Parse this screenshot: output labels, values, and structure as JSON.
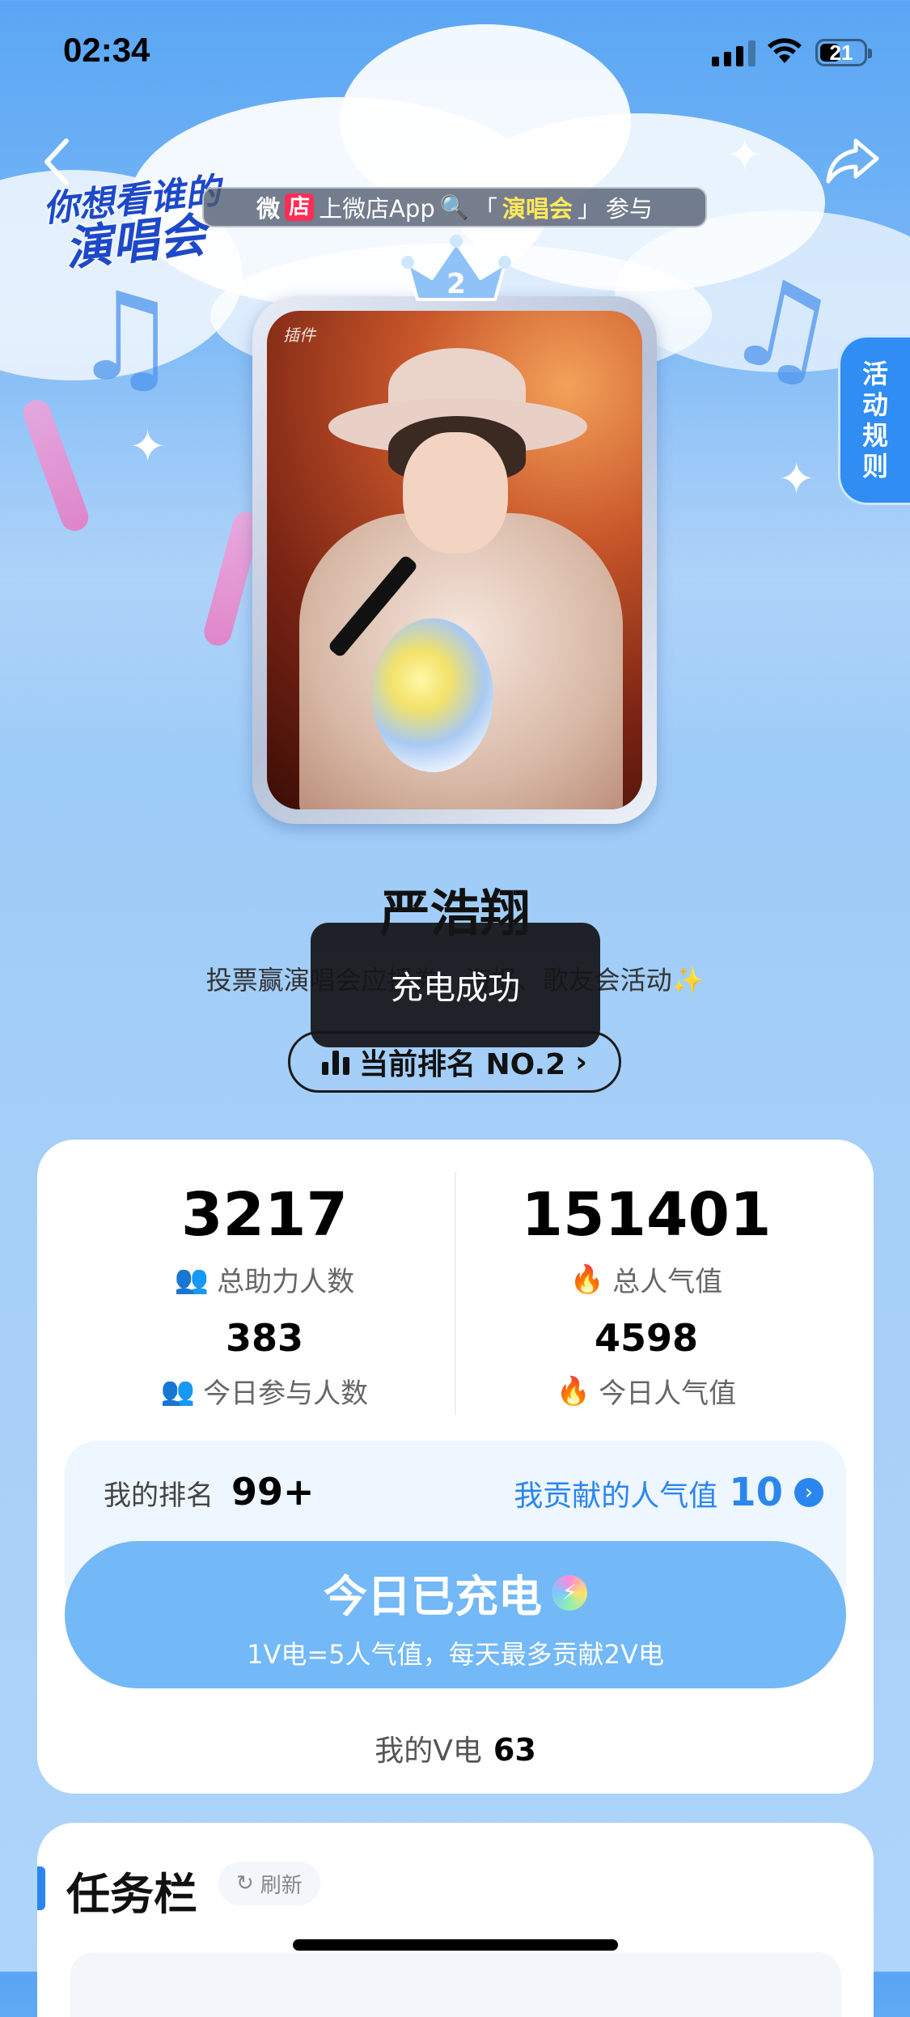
{
  "status_bar": {
    "time": "02:34",
    "battery": "21",
    "signal_bars": 3
  },
  "header": {
    "logo_line1": "你想看谁的",
    "logo_line2": "演唱会",
    "banner": {
      "wei": "微",
      "dian": "店",
      "text1": "上微店App",
      "bracket_open": "「",
      "keyword": "演唱会",
      "bracket_close": "」",
      "text2": "参与"
    },
    "rules_tab": [
      "活",
      "动",
      "规",
      "则"
    ]
  },
  "photo": {
    "rank_badge": "2",
    "signature": "插件"
  },
  "artist": {
    "name": "严浩翔",
    "subtitle": "投票赢演唱会应援券、海报、歌友会活动✨",
    "rank_label": "当前排名 NO.2",
    "toast": "充电成功"
  },
  "stats": {
    "total_helpers": {
      "value": "3217",
      "label": "总助力人数"
    },
    "total_popularity": {
      "value": "151401",
      "label": "总人气值"
    },
    "today_participants": {
      "value": "383",
      "label": "今日参与人数"
    },
    "today_popularity": {
      "value": "4598",
      "label": "今日人气值"
    }
  },
  "my": {
    "rank_label": "我的排名",
    "rank_value": "99+",
    "contrib_label": "我贡献的人气值",
    "contrib_value": "10",
    "charge_title": "今日已充电",
    "charge_desc": "1V电=5人气值，每天最多贡献2V电",
    "v_label": "我的V电",
    "v_value": "63"
  },
  "tasks": {
    "title": "任务栏",
    "refresh_label": "刷新"
  },
  "colors": {
    "accent": "#2a86ee",
    "charge_button": "#73b8f7",
    "rules_tab": "#2f8df3",
    "toast_bg": "#141418"
  }
}
